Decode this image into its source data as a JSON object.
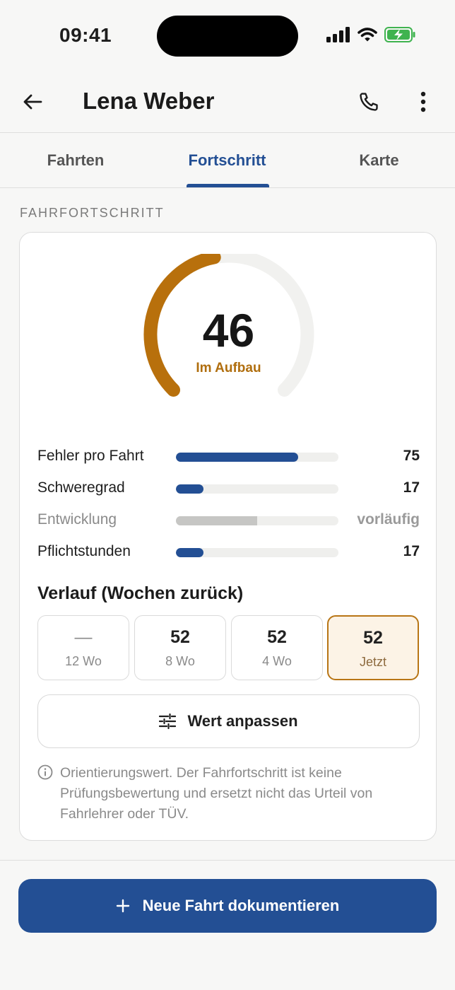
{
  "status_bar": {
    "time": "09:41",
    "icons": [
      "signal-icon",
      "wifi-icon",
      "battery-charging-icon"
    ]
  },
  "header": {
    "back_icon": "arrow-left-icon",
    "title": "Lena Weber",
    "phone_icon": "phone-icon",
    "more_icon": "more-vertical-icon"
  },
  "tabs": [
    {
      "label": "Fahrten",
      "active": false
    },
    {
      "label": "Fortschritt",
      "active": true
    },
    {
      "label": "Karte",
      "active": false
    }
  ],
  "section_label": "FAHRFORTSCHRITT",
  "gauge": {
    "value": "46",
    "value_number": 46,
    "max": 100,
    "status": "Im Aufbau",
    "colors": {
      "progress": "#b8700c",
      "track": "#f1f1ef",
      "status_text": "#b06e0e"
    }
  },
  "metrics": [
    {
      "label": "Fehler pro Fahrt",
      "value": "75",
      "fill": 0.75,
      "muted": false
    },
    {
      "label": "Schweregrad",
      "value": "17",
      "fill": 0.17,
      "muted": false
    },
    {
      "label": "Entwicklung",
      "value": "vorläufig",
      "fill": 0.5,
      "muted": true
    },
    {
      "label": "Pflichtstunden",
      "value": "17",
      "fill": 0.17,
      "muted": false
    }
  ],
  "history": {
    "title": "Verlauf (Wochen zurück)",
    "items": [
      {
        "value": "—",
        "label": "12 Wo",
        "current": false
      },
      {
        "value": "52",
        "label": "8 Wo",
        "current": false
      },
      {
        "value": "52",
        "label": "4 Wo",
        "current": false
      },
      {
        "value": "52",
        "label": "Jetzt",
        "current": true
      }
    ]
  },
  "adjust_button": {
    "icon": "sliders-icon",
    "label": "Wert anpassen"
  },
  "note": {
    "icon": "info-icon",
    "text": "Orientierungswert. Der Fahrfortschritt ist keine Prüfungsbewertung und ersetzt nicht das Urteil von Fahrlehrer oder TÜV."
  },
  "cta": {
    "icon": "plus-icon",
    "label": "Neue Fahrt dokumentieren"
  },
  "colors": {
    "primary": "#234f94",
    "accent": "#b8700c",
    "background": "#f7f7f6"
  }
}
